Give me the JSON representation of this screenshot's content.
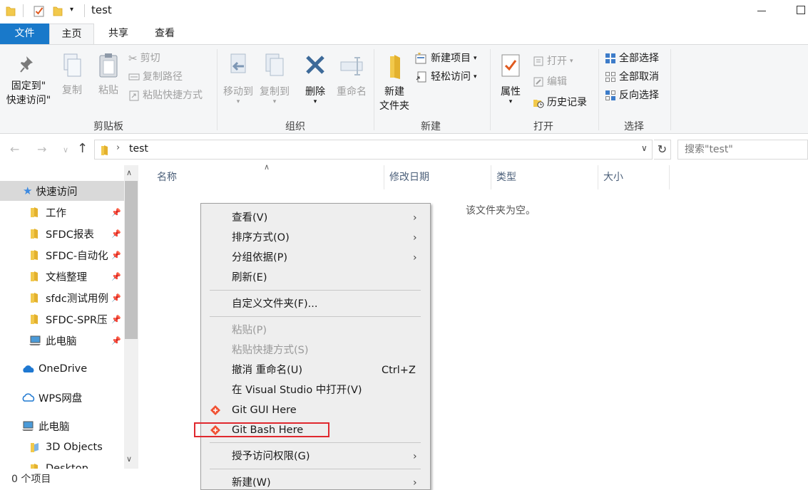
{
  "window": {
    "title": "test"
  },
  "ribbon": {
    "tabs": [
      "文件",
      "主页",
      "共享",
      "查看"
    ],
    "clipboard": {
      "pin_line1": "固定到\"",
      "pin_line2": "快速访问\"",
      "copy": "复制",
      "paste": "粘贴",
      "cut": "剪切",
      "copy_path": "复制路径",
      "paste_shortcut": "粘贴快捷方式",
      "group_label": "剪贴板"
    },
    "organize": {
      "move_to": "移动到",
      "copy_to": "复制到",
      "delete": "删除",
      "rename": "重命名",
      "group_label": "组织"
    },
    "new": {
      "new_folder_line1": "新建",
      "new_folder_line2": "文件夹",
      "new_item": "新建项目",
      "easy_access": "轻松访问",
      "group_label": "新建"
    },
    "open": {
      "properties": "属性",
      "open": "打开",
      "edit": "编辑",
      "history": "历史记录",
      "group_label": "打开"
    },
    "select": {
      "select_all": "全部选择",
      "select_none": "全部取消",
      "invert": "反向选择",
      "group_label": "选择"
    }
  },
  "address": {
    "path": "test",
    "search_placeholder": "搜索\"test\""
  },
  "navigation": {
    "items": [
      {
        "label": "快速访问",
        "icon": "star-icon",
        "pinned": false
      },
      {
        "label": "工作",
        "icon": "folder-icon",
        "pinned": true
      },
      {
        "label": "SFDC报表",
        "icon": "folder-icon",
        "pinned": true
      },
      {
        "label": "SFDC-自动化",
        "icon": "folder-icon",
        "pinned": true
      },
      {
        "label": "文档整理",
        "icon": "folder-icon",
        "pinned": true
      },
      {
        "label": "sfdc测试用例",
        "icon": "folder-icon",
        "pinned": true
      },
      {
        "label": "SFDC-SPR压",
        "icon": "folder-icon",
        "pinned": true
      },
      {
        "label": "此电脑",
        "icon": "computer-icon",
        "pinned": true
      },
      {
        "label": "OneDrive",
        "icon": "cloud-icon",
        "pinned": false
      },
      {
        "label": "WPS网盘",
        "icon": "cloud-outline-icon",
        "pinned": false
      },
      {
        "label": "此电脑",
        "icon": "computer-icon",
        "pinned": false
      },
      {
        "label": "3D Objects",
        "icon": "cube-folder-icon",
        "pinned": false
      },
      {
        "label": "Desktop",
        "icon": "folder-icon",
        "pinned": false
      }
    ]
  },
  "columns": {
    "name": "名称",
    "modified": "修改日期",
    "type": "类型",
    "size": "大小"
  },
  "content": {
    "empty_message": "该文件夹为空。"
  },
  "status": {
    "items_count": "0 个项目"
  },
  "context_menu": {
    "items": [
      {
        "label": "查看(V)"
      },
      {
        "label": "排序方式(O)"
      },
      {
        "label": "分组依据(P)"
      },
      {
        "label": "刷新(E)"
      },
      {
        "label": "自定义文件夹(F)..."
      },
      {
        "label": "粘贴(P)"
      },
      {
        "label": "粘贴快捷方式(S)"
      },
      {
        "label": "撤消 重命名(U)",
        "shortcut": "Ctrl+Z"
      },
      {
        "label": "在 Visual Studio 中打开(V)"
      },
      {
        "label": "Git GUI Here"
      },
      {
        "label": "Git Bash Here"
      },
      {
        "label": "授予访问权限(G)"
      },
      {
        "label": "新建(W)"
      }
    ]
  },
  "colors": {
    "accent": "#1979ca",
    "highlight_border": "#e0282e",
    "folder": "#f2c94c",
    "git": "#f05133"
  }
}
